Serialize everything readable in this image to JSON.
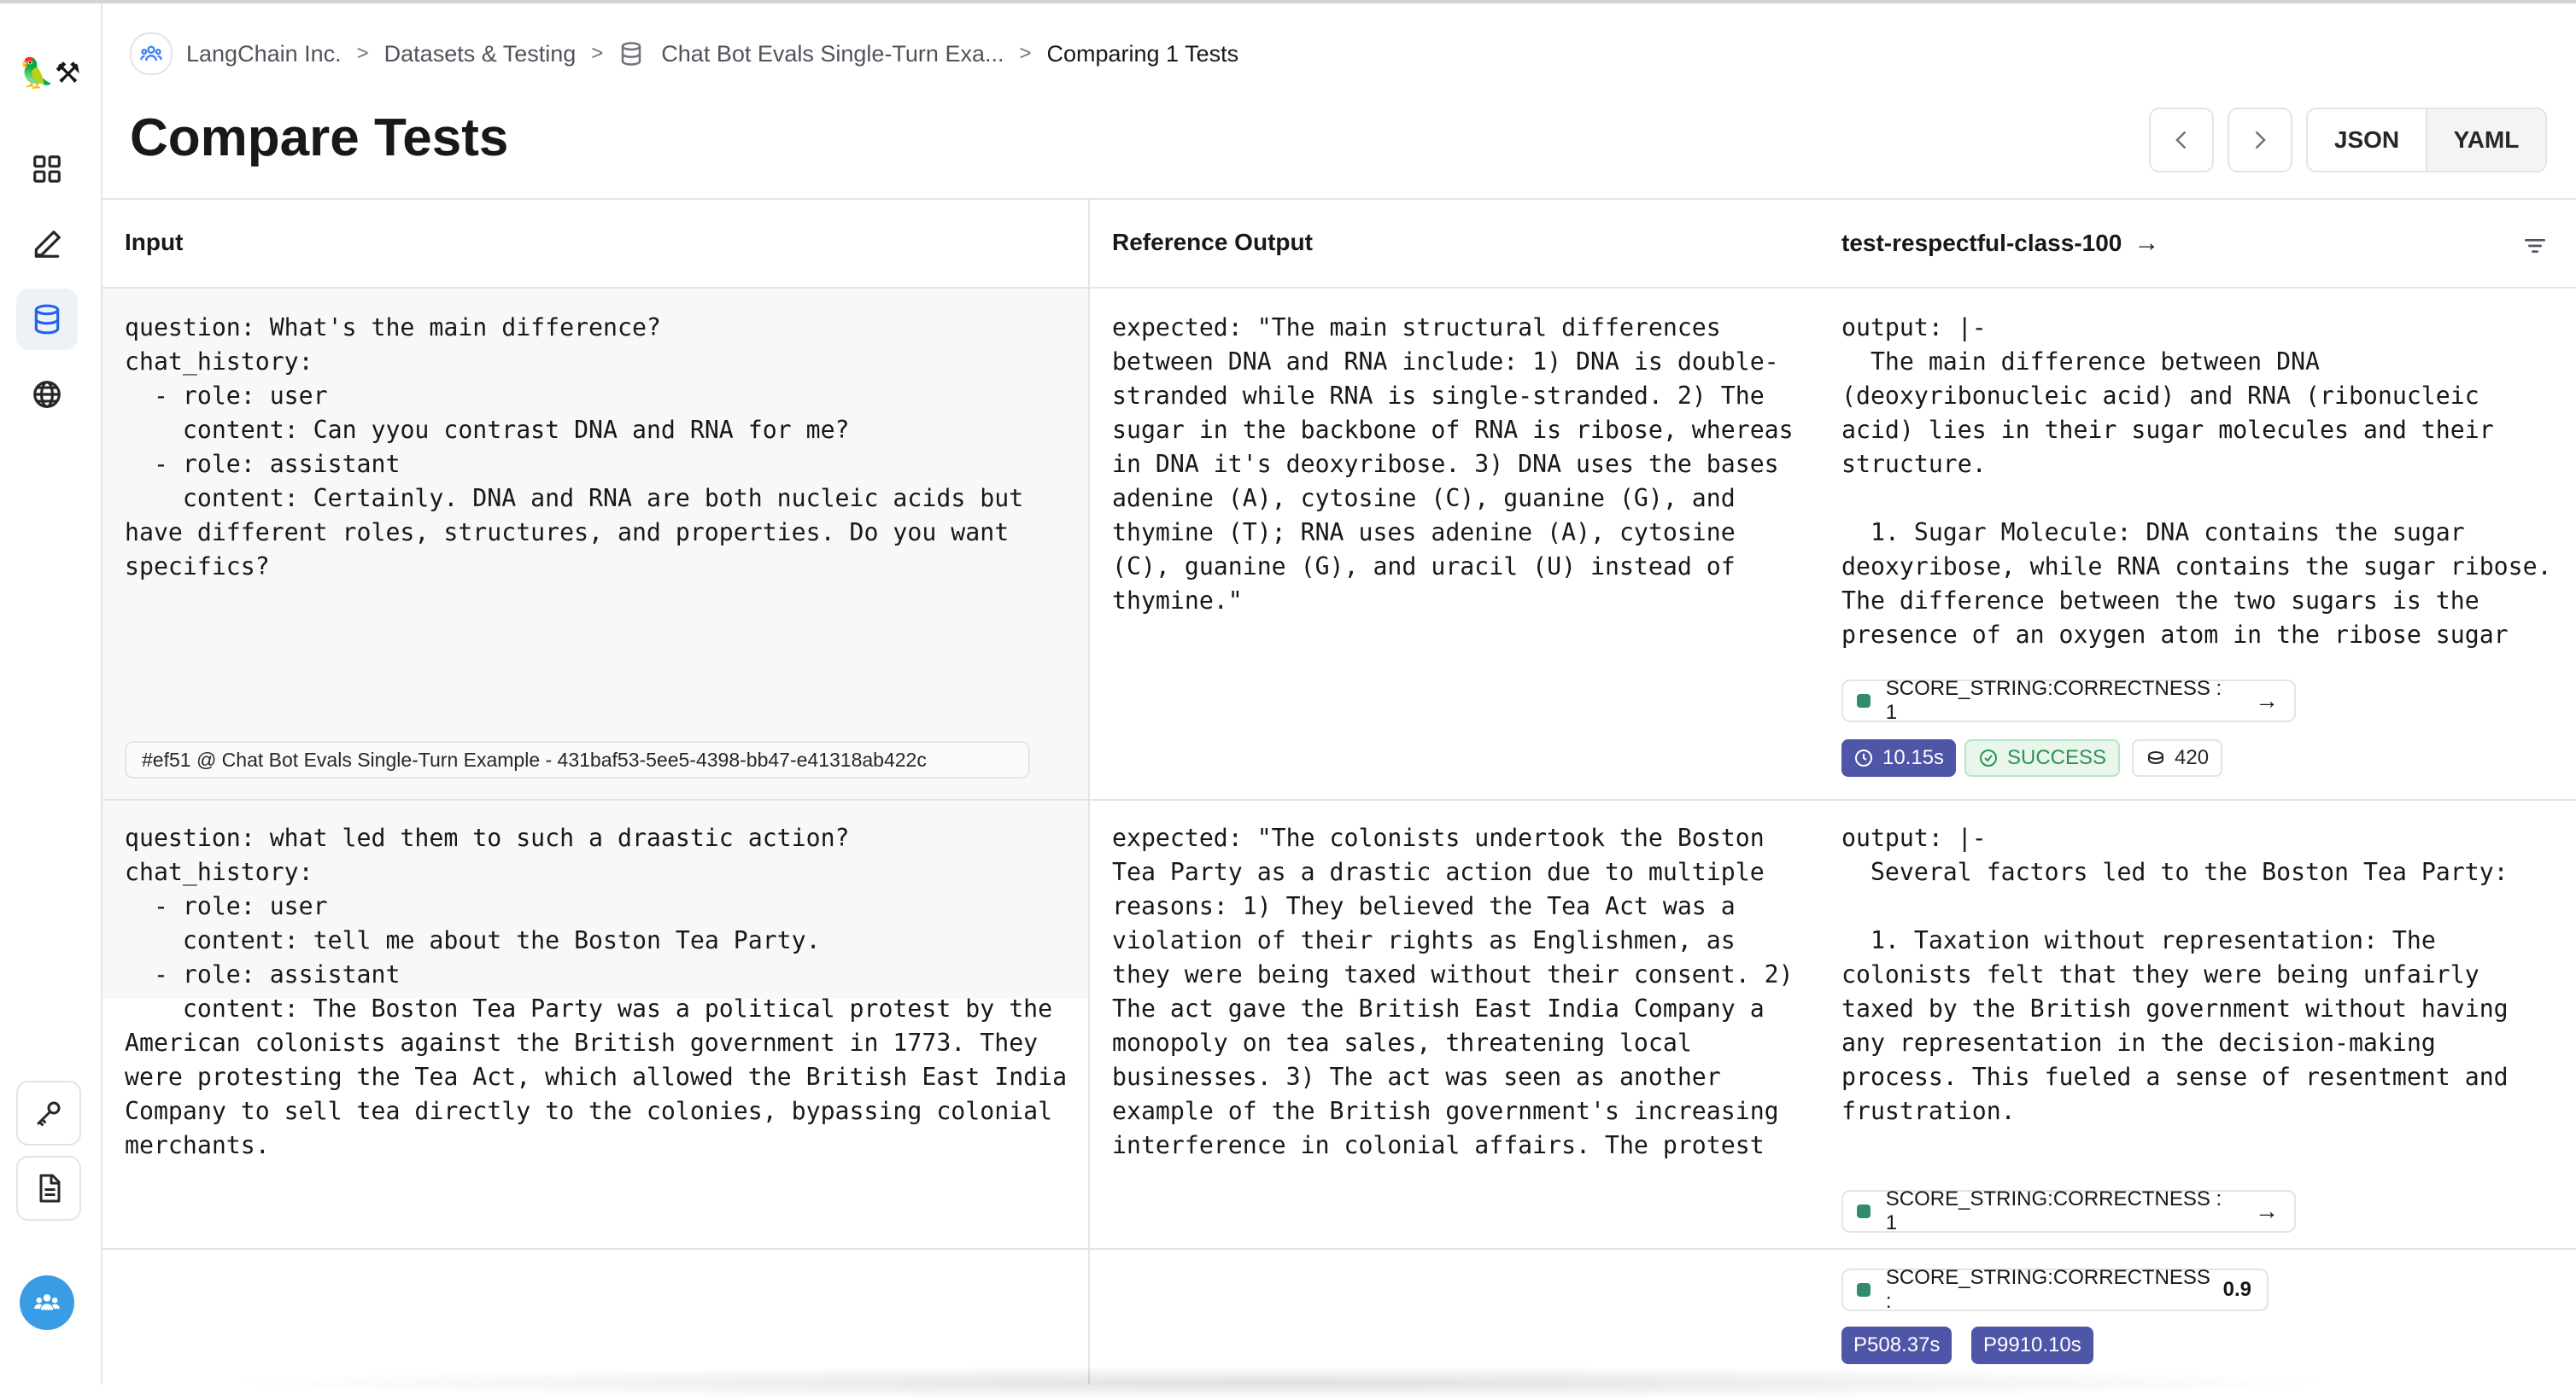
{
  "app": {
    "logo_text": "🦜⚒"
  },
  "breadcrumb": {
    "org": "LangChain Inc.",
    "section": "Datasets & Testing",
    "dataset": "Chat Bot Evals Single-Turn Exa...",
    "current": "Comparing 1 Tests",
    "separator": ">"
  },
  "page": {
    "title": "Compare Tests"
  },
  "toolbar": {
    "prev_icon": "chevron-left-icon",
    "next_icon": "chevron-right-icon",
    "json_label": "JSON",
    "yaml_label": "YAML",
    "selected_format": "YAML"
  },
  "table": {
    "columns": {
      "input": "Input",
      "reference": "Reference Output",
      "test": "test-respectful-class-100",
      "test_arrow": "→"
    },
    "rows": [
      {
        "input": "question: What's the main difference?\nchat_history:\n  - role: user\n    content: Can yyou contrast DNA and RNA for me?\n  - role: assistant\n    content: Certainly. DNA and RNA are both nucleic acids but\nhave different roles, structures, and properties. Do you want\nspecifics?",
        "example_ref": "#ef51 @ Chat Bot Evals Single-Turn Example - 431baf53-5ee5-4398-bb47-e41318ab422c",
        "reference": "expected: \"The main structural differences\nbetween DNA and RNA include: 1) DNA is double-\nstranded while RNA is single-stranded. 2) The\nsugar in the backbone of RNA is ribose, whereas\nin DNA it's deoxyribose. 3) DNA uses the bases\nadenine (A), cytosine (C), guanine (G), and\nthymine (T); RNA uses adenine (A), cytosine\n(C), guanine (G), and uracil (U) instead of\nthymine.\"",
        "output": "output: |-\n  The main difference between DNA\n(deoxyribonucleic acid) and RNA (ribonucleic\nacid) lies in their sugar molecules and their\nstructure.\n\n  1. Sugar Molecule: DNA contains the sugar\ndeoxyribose, while RNA contains the sugar ribose.\nThe difference between the two sugars is the\npresence of an oxygen atom in the ribose sugar",
        "score": "SCORE_STRING:CORRECTNESS : 1",
        "latency": "10.15s",
        "status": "SUCCESS",
        "tokens": "420"
      },
      {
        "input": "question: what led them to such a draastic action?\nchat_history:\n  - role: user\n    content: tell me about the Boston Tea Party.\n  - role: assistant\n    content: The Boston Tea Party was a political protest by the\nAmerican colonists against the British government in 1773. They\nwere protesting the Tea Act, which allowed the British East India\nCompany to sell tea directly to the colonies, bypassing colonial\nmerchants.",
        "reference": "expected: \"The colonists undertook the Boston\nTea Party as a drastic action due to multiple\nreasons: 1) They believed the Tea Act was a\nviolation of their rights as Englishmen, as\nthey were being taxed without their consent. 2)\nThe act gave the British East India Company a\nmonopoly on tea sales, threatening local\nbusinesses. 3) The act was seen as another\nexample of the British government's increasing\ninterference in colonial affairs. The protest",
        "output": "output: |-\n  Several factors led to the Boston Tea Party:\n\n  1. Taxation without representation: The\ncolonists felt that they were being unfairly\ntaxed by the British government without having\nany representation in the decision-making\nprocess. This fueled a sense of resentment and\nfrustration.",
        "score": "SCORE_STRING:CORRECTNESS : 1"
      }
    ],
    "summary": {
      "score_label": "SCORE_STRING:CORRECTNESS : ",
      "score_value": "0.9",
      "p50": "P508.37s",
      "p99": "P9910.10s"
    }
  },
  "colors": {
    "accent": "#4f55a7",
    "success_bg": "#e8f6ec",
    "success_text": "#2e9254",
    "score_dot": "#2f8a6e",
    "avatar": "#3b9ce6"
  }
}
